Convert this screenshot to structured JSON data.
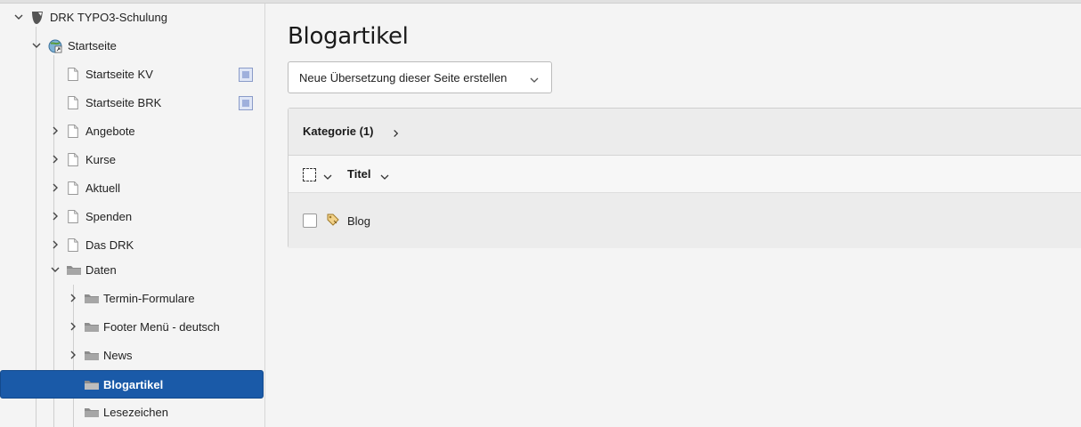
{
  "tree": {
    "nodes": [
      {
        "label": "DRK TYPO3-Schulung",
        "icon": "typo3-logo-icon"
      },
      {
        "label": "Startseite",
        "icon": "site-root-icon"
      },
      {
        "label": "Startseite KV",
        "icon": "page-icon"
      },
      {
        "label": "Startseite BRK",
        "icon": "page-icon"
      },
      {
        "label": "Angebote",
        "icon": "page-icon"
      },
      {
        "label": "Kurse",
        "icon": "page-icon"
      },
      {
        "label": "Aktuell",
        "icon": "page-icon"
      },
      {
        "label": "Spenden",
        "icon": "page-icon"
      },
      {
        "label": "Das DRK",
        "icon": "page-icon"
      },
      {
        "label": "Daten",
        "icon": "folder-icon"
      },
      {
        "label": "Termin-Formulare",
        "icon": "folder-icon"
      },
      {
        "label": "Footer Menü - deutsch",
        "icon": "folder-icon"
      },
      {
        "label": "News",
        "icon": "folder-icon"
      },
      {
        "label": "Blogartikel",
        "icon": "folder-icon"
      },
      {
        "label": "Lesezeichen",
        "icon": "folder-icon"
      }
    ]
  },
  "main": {
    "title": "Blogartikel",
    "translation_select": "Neue Übersetzung dieser Seite erstellen",
    "panel": {
      "heading": "Kategorie (1)",
      "column_title": "Titel",
      "rows": [
        {
          "label": "Blog",
          "icon": "category-tag-icon"
        }
      ]
    }
  },
  "colors": {
    "selection": "#1a5aa8",
    "background": "#f4f4f4"
  }
}
